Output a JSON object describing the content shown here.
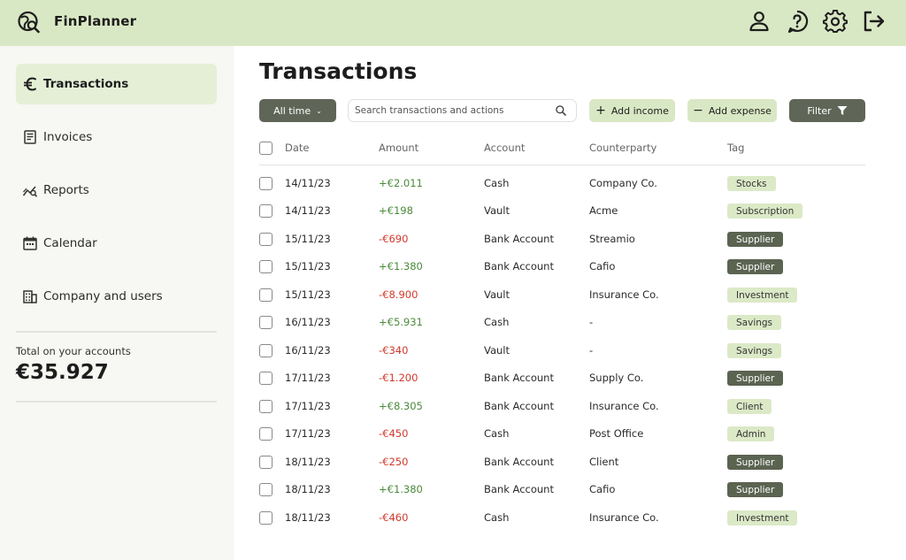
{
  "app": {
    "title": "FinPlanner"
  },
  "topbar": {
    "icons": [
      "user-icon",
      "help-icon",
      "settings-icon",
      "logout-icon"
    ]
  },
  "sidebar": {
    "items": [
      {
        "label": "Transactions",
        "icon": "euro-icon",
        "active": true
      },
      {
        "label": "Invoices",
        "icon": "invoice-icon",
        "active": false
      },
      {
        "label": "Reports",
        "icon": "reports-icon",
        "active": false
      },
      {
        "label": "Calendar",
        "icon": "calendar-icon",
        "active": false
      },
      {
        "label": "Company and users",
        "icon": "company-icon",
        "active": false
      }
    ],
    "total_label": "Total on your accounts",
    "total_value": "€35.927"
  },
  "main": {
    "title": "Transactions",
    "period_filter": "All time",
    "search_placeholder": "Search transactions and actions",
    "add_income_label": "Add income",
    "add_expense_label": "Add expense",
    "filter_label": "Filter"
  },
  "table": {
    "columns": [
      "Date",
      "Amount",
      "Account",
      "Counterparty",
      "Tag"
    ],
    "rows": [
      {
        "date": "14/11/23",
        "amount": "+€2.011",
        "account": "Cash",
        "counterparty": "Company Co.",
        "tag": "Stocks",
        "tag_style": "light"
      },
      {
        "date": "14/11/23",
        "amount": "+€198",
        "account": "Vault",
        "counterparty": "Acme",
        "tag": "Subscription",
        "tag_style": "light"
      },
      {
        "date": "15/11/23",
        "amount": "-€690",
        "account": "Bank Account",
        "counterparty": "Streamio",
        "tag": "Supplier",
        "tag_style": "dark"
      },
      {
        "date": "15/11/23",
        "amount": "+€1.380",
        "account": "Bank Account",
        "counterparty": "Cafio",
        "tag": "Supplier",
        "tag_style": "dark"
      },
      {
        "date": "15/11/23",
        "amount": "-€8.900",
        "account": "Vault",
        "counterparty": "Insurance Co.",
        "tag": "Investment",
        "tag_style": "light"
      },
      {
        "date": "16/11/23",
        "amount": "+€5.931",
        "account": "Cash",
        "counterparty": "-",
        "tag": "Savings",
        "tag_style": "light"
      },
      {
        "date": "16/11/23",
        "amount": "-€340",
        "account": "Vault",
        "counterparty": "-",
        "tag": "Savings",
        "tag_style": "light"
      },
      {
        "date": "17/11/23",
        "amount": "-€1.200",
        "account": "Bank Account",
        "counterparty": "Supply Co.",
        "tag": "Supplier",
        "tag_style": "dark"
      },
      {
        "date": "17/11/23",
        "amount": "+€8.305",
        "account": "Bank Account",
        "counterparty": "Insurance Co.",
        "tag": "Client",
        "tag_style": "light"
      },
      {
        "date": "17/11/23",
        "amount": "-€450",
        "account": "Cash",
        "counterparty": "Post Office",
        "tag": "Admin",
        "tag_style": "light"
      },
      {
        "date": "18/11/23",
        "amount": "-€250",
        "account": "Bank Account",
        "counterparty": "Client",
        "tag": "Supplier",
        "tag_style": "dark"
      },
      {
        "date": "18/11/23",
        "amount": "+€1.380",
        "account": "Bank Account",
        "counterparty": "Cafio",
        "tag": "Supplier",
        "tag_style": "dark"
      },
      {
        "date": "18/11/23",
        "amount": "-€460",
        "account": "Cash",
        "counterparty": "Insurance Co.",
        "tag": "Investment",
        "tag_style": "light"
      }
    ]
  },
  "colors": {
    "topbar": "#d9e8c4",
    "sidebar_bg": "#f7f7f3",
    "active_item": "#e5efd6",
    "dark_button": "#5f6657",
    "positive": "#4a8a3a",
    "negative": "#d13a2e",
    "tag_light": "#dbe9c7",
    "tag_dark": "#5b6351"
  }
}
